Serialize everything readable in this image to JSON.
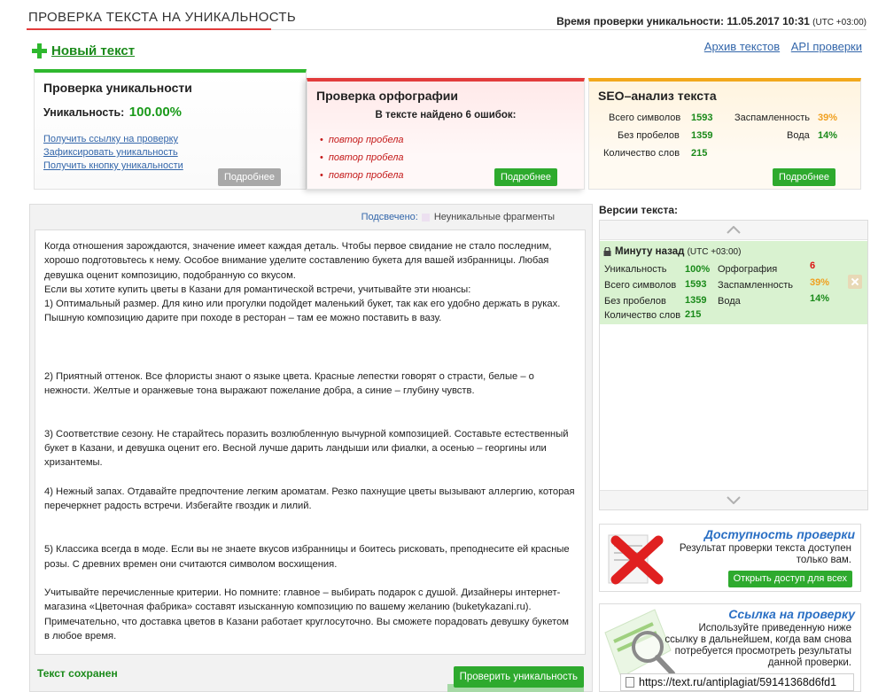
{
  "header": {
    "page_title": "ПРОВЕРКА ТЕКСТА НА УНИКАЛЬНОСТЬ",
    "check_time_label": "Время проверки уникальности: 11.05.2017 10:31",
    "check_time_tz": "(UTC +03:00)"
  },
  "new_text_label": "Новый текст",
  "top_links": {
    "archive": "Архив текстов",
    "api": "API проверки"
  },
  "uniqueness_card": {
    "title": "Проверка уникальности",
    "label": "Уникальность:",
    "value": "100.00%",
    "links": [
      "Получить ссылку на проверку",
      "Зафиксировать уникальность",
      "Получить кнопку уникальности"
    ],
    "more_button": "Подробнее"
  },
  "spelling_card": {
    "title": "Проверка орфографии",
    "found_text": "В тексте найдено 6 ошибок:",
    "errors": [
      "повтор пробела",
      "повтор пробела",
      "повтор пробела"
    ],
    "more_button": "Подробнее"
  },
  "seo_card": {
    "title": "SEO–анализ текста",
    "stats": [
      {
        "label": "Всего символов",
        "value": "1593"
      },
      {
        "label": "Заспамленность",
        "value": "39%"
      },
      {
        "label": "Без пробелов",
        "value": "1359"
      },
      {
        "label": "Вода",
        "value": "14%"
      },
      {
        "label": "Количество слов",
        "value": "215"
      }
    ],
    "more_button": "Подробнее"
  },
  "text_panel": {
    "highlight_label": "Подсвечено:",
    "highlight_legend": "Неуникальные фрагменты",
    "paragraphs": [
      "Когда отношения зарождаются, значение имеет каждая деталь. Чтобы первое свидание не стало последним, хорошо подготовьтесь к нему. Особое внимание уделите составлению букета для вашей избранницы. Любая девушка оценит композицию, подобранную со вкусом.",
      "Если вы хотите купить цветы в Казани для романтической встречи, учитывайте эти нюансы:",
      "1)    Оптимальный размер. Для кино или прогулки подойдет маленький букет, так как его удобно держать в руках. Пышную композицию дарите при походе в ресторан – там ее можно поставить в вазу.",
      "",
      "",
      "",
      "2)    Приятный оттенок. Все флористы знают о языке цвета. Красные лепестки говорят о страсти, белые – о нежности. Желтые и оранжевые тона выражают пожелание добра, а синие – глубину чувств.",
      "",
      "",
      "3)    Соответствие сезону. Не старайтесь поразить возлюбленную вычурной композицией. Составьте естественный букет в Казани, и девушка оценит его. Весной лучше дарить ландыши или фиалки, а осенью – георгины или хризантемы.",
      "",
      "4)    Нежный запах. Отдавайте предпочтение легким ароматам. Резко пахнущие цветы вызывают аллергию, которая перечеркнет радость встречи. Избегайте гвоздик и лилий.",
      "",
      "",
      "5)    Классика всегда в моде. Если вы не знаете вкусов избранницы и боитесь рисковать, преподнесите ей красные розы. С древних времен они считаются символом восхищения.",
      "",
      "Учитывайте перечисленные критерии. Но помните: главное – выбирать подарок с душой. Дизайнеры интернет-магазина «Цветочная фабрика» составят изысканную композицию по вашему желанию (buketykazani.ru). Примечательно, что доставка цветов в Казани работает круглосуточно. Вы сможете порадовать девушку букетом в любое время."
    ],
    "saved_status": "Текст сохранен",
    "check_button": "Проверить уникальность"
  },
  "versions": {
    "title": "Версии текста:",
    "item": {
      "header": "Минуту назад",
      "tz": "(UTC +03:00)",
      "stats": [
        {
          "label": "Уникальность",
          "value": "100%"
        },
        {
          "label": "Орфография",
          "value": "6"
        },
        {
          "label": "Всего символов",
          "value": "1593"
        },
        {
          "label": "Заспамленность",
          "value": "39%"
        },
        {
          "label": "Без пробелов",
          "value": "1359"
        },
        {
          "label": "Вода",
          "value": "14%"
        },
        {
          "label": "Количество слов",
          "value": "215"
        }
      ]
    }
  },
  "promo_access": {
    "title": "Доступность проверки",
    "text": [
      "Результат проверки текста доступен",
      "только вам."
    ],
    "button": "Открыть доступ для всех"
  },
  "promo_link": {
    "title": "Ссылка на проверку",
    "text": [
      "Используйте приведенную ниже",
      "ссылку в дальнейшем, когда вам снова",
      "потребуется просмотреть результаты",
      "данной проверки."
    ],
    "url": "https://text.ru/antiplagiat/59141368d6fd1"
  },
  "colors": {
    "accent_green": "#2eaa2e",
    "accent_red": "#e23b3b",
    "accent_orange": "#f2a81c",
    "link_blue": "#3366aa"
  }
}
